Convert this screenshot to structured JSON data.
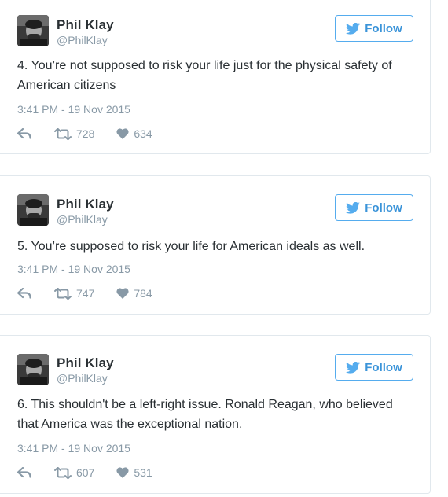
{
  "tweets": [
    {
      "author_name": "Phil Klay",
      "author_handle": "@PhilKlay",
      "follow_label": "Follow",
      "text": "4. You’re not supposed to risk your life just for the physical safety of American citizens",
      "timestamp": "3:41 PM - 19 Nov 2015",
      "retweets": "728",
      "likes": "634"
    },
    {
      "author_name": "Phil Klay",
      "author_handle": "@PhilKlay",
      "follow_label": "Follow",
      "text": "5. You’re supposed to risk your life for American ideals as well.",
      "timestamp": "3:41 PM - 19 Nov 2015",
      "retweets": "747",
      "likes": "784"
    },
    {
      "author_name": "Phil Klay",
      "author_handle": "@PhilKlay",
      "follow_label": "Follow",
      "text": "6. This shouldn't be a left-right issue. Ronald Reagan, who believed that America was the exceptional nation,",
      "timestamp": "3:41 PM - 19 Nov 2015",
      "retweets": "607",
      "likes": "531"
    }
  ],
  "icons": {
    "bird": "twitter-bird-icon",
    "reply": "reply-icon",
    "retweet": "retweet-icon",
    "like": "heart-icon"
  },
  "colors": {
    "accent": "#55acee",
    "follow_text": "#3b94d9",
    "muted": "#8899a6",
    "text": "#292f33",
    "border": "#e1e8ed"
  }
}
